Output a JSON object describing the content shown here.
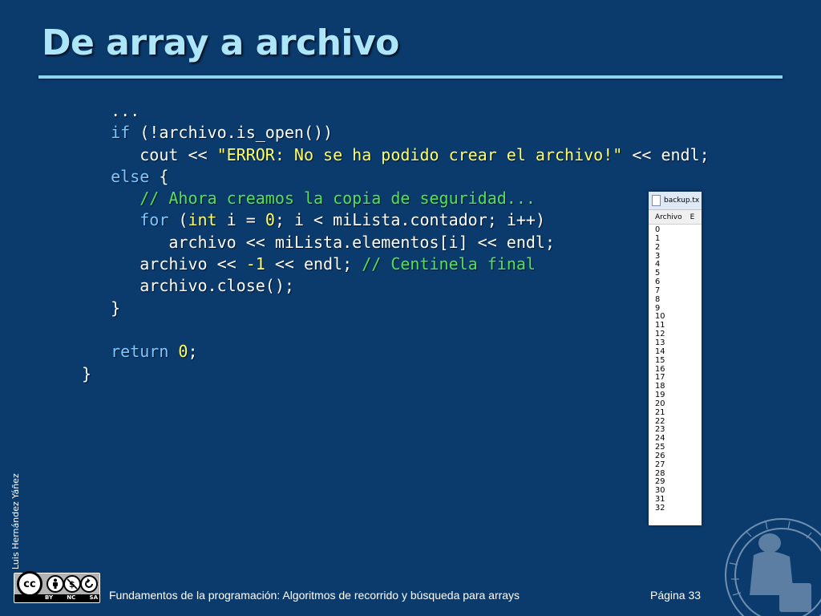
{
  "slide": {
    "title": "De array a archivo",
    "author": "Luis Hernández Yáñez",
    "footer": "Fundamentos de la programación: Algoritmos de recorrido y búsqueda para arrays",
    "page": "Página 33"
  },
  "code": [
    [
      {
        "t": "   ...",
        "c": ""
      }
    ],
    [
      {
        "t": "   ",
        "c": ""
      },
      {
        "t": "if",
        "c": "kw"
      },
      {
        "t": " (!archivo.is_open())",
        "c": ""
      }
    ],
    [
      {
        "t": "      cout << ",
        "c": ""
      },
      {
        "t": "\"ERROR: No se ha podido crear el archivo!\"",
        "c": "str"
      },
      {
        "t": " << endl;",
        "c": ""
      }
    ],
    [
      {
        "t": "   ",
        "c": ""
      },
      {
        "t": "else",
        "c": "kw"
      },
      {
        "t": " {",
        "c": ""
      }
    ],
    [
      {
        "t": "      ",
        "c": ""
      },
      {
        "t": "// Ahora creamos la copia de seguridad...",
        "c": "cmt"
      }
    ],
    [
      {
        "t": "      ",
        "c": ""
      },
      {
        "t": "for",
        "c": "kw"
      },
      {
        "t": " (",
        "c": ""
      },
      {
        "t": "int",
        "c": "num"
      },
      {
        "t": " i = ",
        "c": ""
      },
      {
        "t": "0",
        "c": "num"
      },
      {
        "t": "; i < miLista.contador; i++)",
        "c": ""
      }
    ],
    [
      {
        "t": "         archivo << miLista.elementos[i] << endl;",
        "c": ""
      }
    ],
    [
      {
        "t": "      archivo << ",
        "c": ""
      },
      {
        "t": "-1",
        "c": "num"
      },
      {
        "t": " << endl; ",
        "c": ""
      },
      {
        "t": "// Centinela final",
        "c": "cmt"
      }
    ],
    [
      {
        "t": "      archivo.close();",
        "c": ""
      }
    ],
    [
      {
        "t": "   }",
        "c": ""
      }
    ],
    [
      {
        "t": "",
        "c": ""
      }
    ],
    [
      {
        "t": "   ",
        "c": ""
      },
      {
        "t": "return",
        "c": "kw"
      },
      {
        "t": " ",
        "c": ""
      },
      {
        "t": "0",
        "c": "num"
      },
      {
        "t": ";",
        "c": ""
      }
    ],
    [
      {
        "t": "}",
        "c": ""
      }
    ]
  ],
  "notepad": {
    "file_name": "backup.tx",
    "menu": [
      "Archivo",
      "E"
    ],
    "lines": [
      "0",
      "1",
      "2",
      "3",
      "4",
      "5",
      "6",
      "7",
      "8",
      "9",
      "10",
      "11",
      "12",
      "13",
      "14",
      "15",
      "16",
      "17",
      "18",
      "19",
      "20",
      "21",
      "22",
      "23",
      "24",
      "25",
      "26",
      "27",
      "28",
      "29",
      "30",
      "31",
      "32"
    ]
  },
  "license": {
    "main": "cc",
    "labels": [
      "BY",
      "NC",
      "SA"
    ]
  },
  "colors": {
    "background": "#0b3a6d",
    "title": "#aee6f9",
    "keyword": "#7fc6ff",
    "literal": "#ffff66",
    "comment": "#56e05a"
  }
}
